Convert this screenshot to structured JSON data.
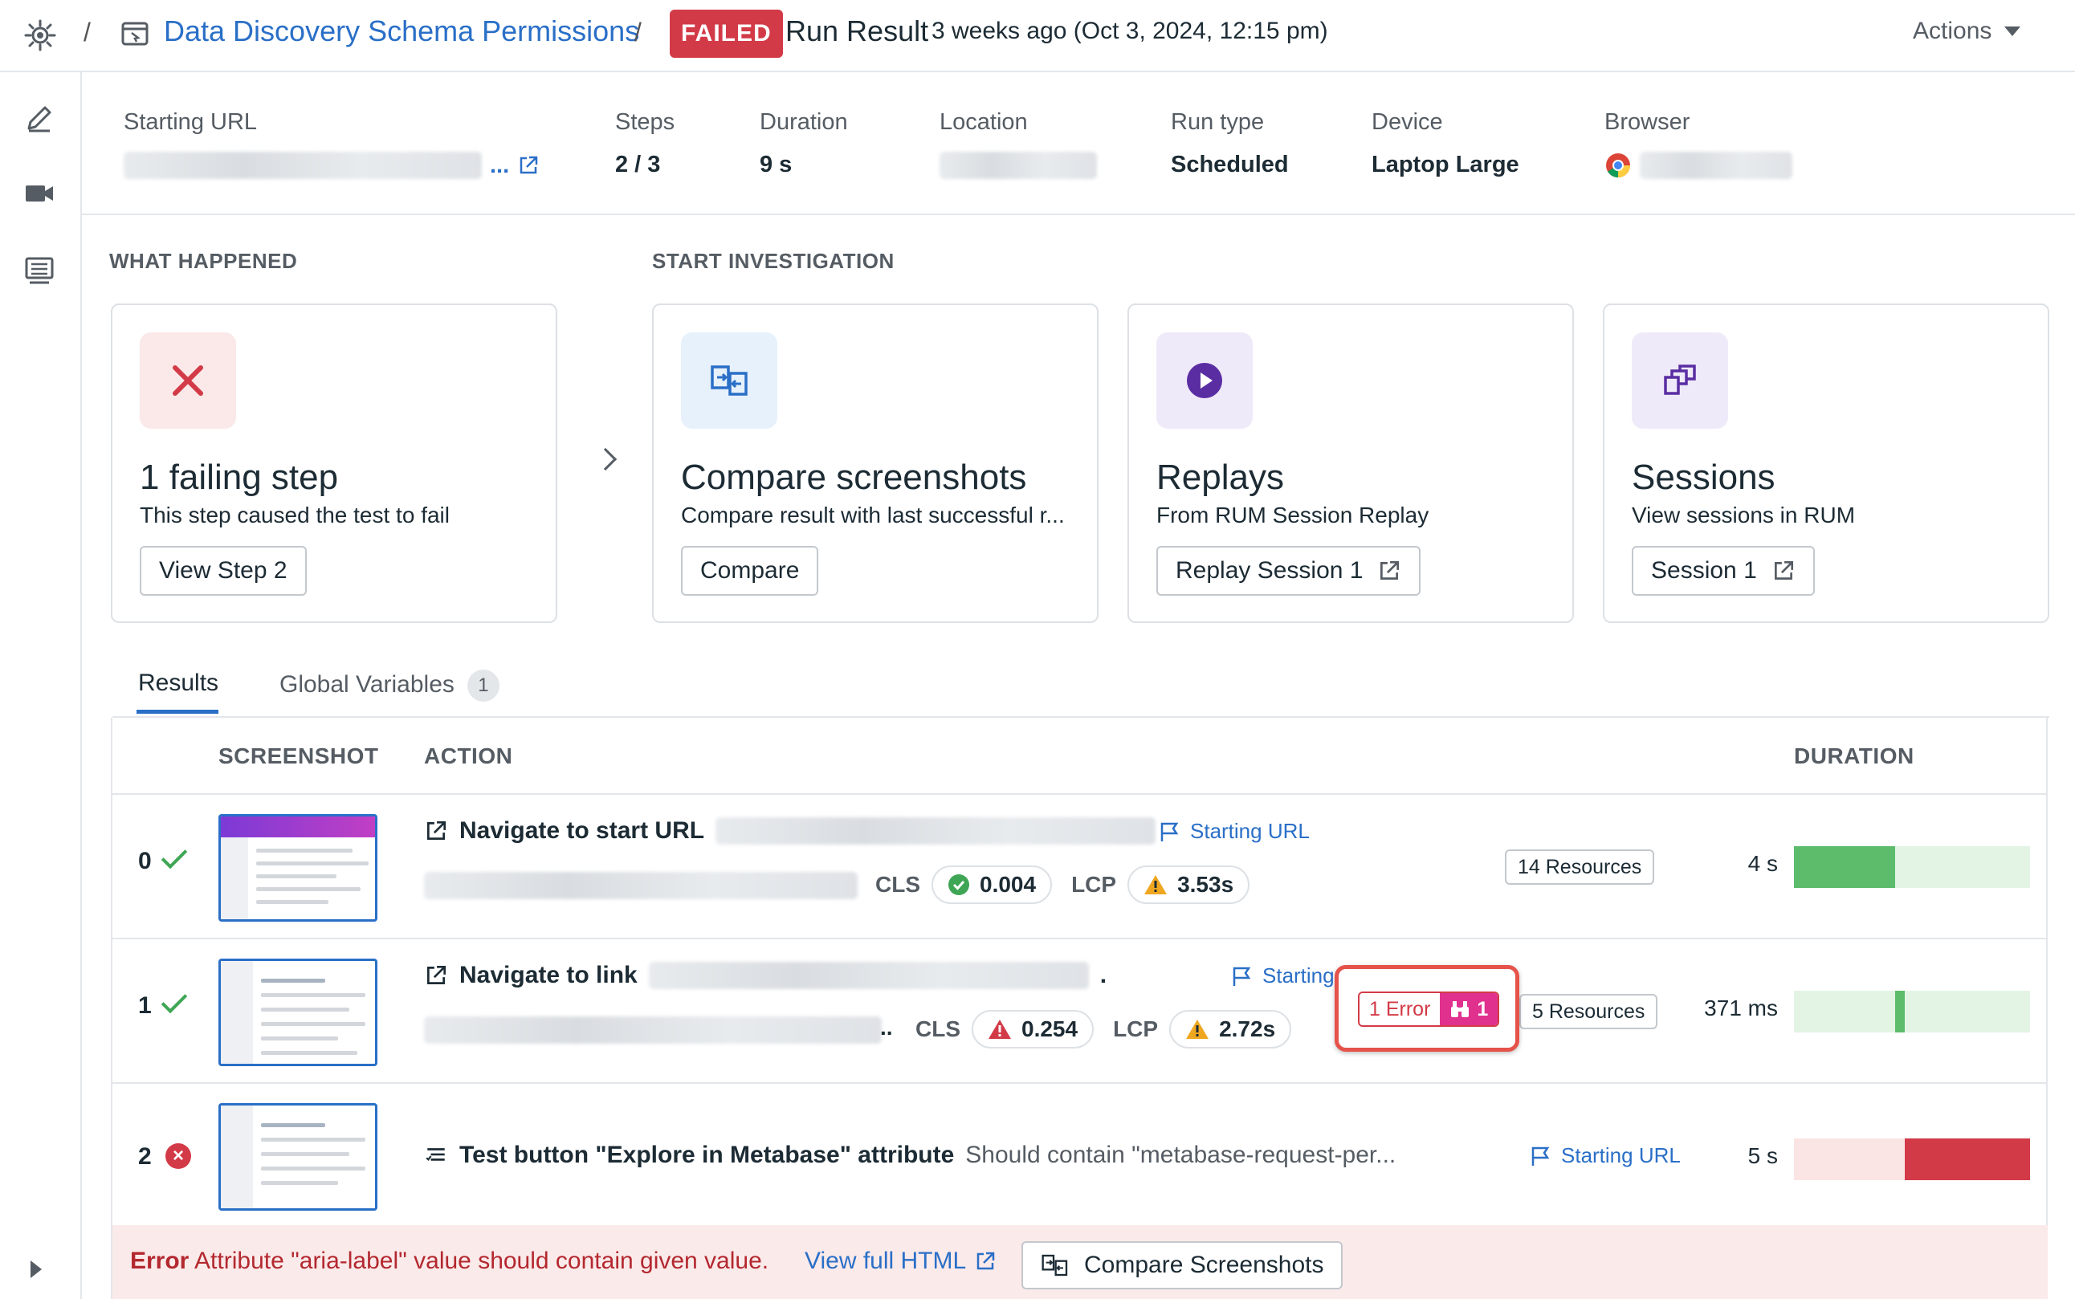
{
  "header": {
    "test_title": "Data Discovery Schema Permissions",
    "status_badge": "FAILED",
    "page_title": "Run Result",
    "run_time": "3 weeks ago (Oct 3, 2024, 12:15 pm)",
    "actions_label": "Actions",
    "separator": "/"
  },
  "meta": {
    "starting_url_label": "Starting URL",
    "starting_url_ellipsis": "...",
    "steps_label": "Steps",
    "steps_value": "2 / 3",
    "duration_label": "Duration",
    "duration_value": "9 s",
    "location_label": "Location",
    "run_type_label": "Run type",
    "run_type_value": "Scheduled",
    "device_label": "Device",
    "device_value": "Laptop Large",
    "browser_label": "Browser"
  },
  "sections": {
    "what_happened": "WHAT HAPPENED",
    "start_investigation": "START INVESTIGATION"
  },
  "cards": [
    {
      "title": "1 failing step",
      "desc": "This step caused the test to fail",
      "button": "View Step 2"
    },
    {
      "title": "Compare screenshots",
      "desc": "Compare result with last successful r...",
      "button": "Compare"
    },
    {
      "title": "Replays",
      "desc": "From RUM Session Replay",
      "button": "Replay Session 1"
    },
    {
      "title": "Sessions",
      "desc": "View sessions in RUM",
      "button": "Session 1"
    }
  ],
  "tabs": [
    {
      "label": "Results"
    },
    {
      "label": "Global Variables",
      "count": "1"
    }
  ],
  "table": {
    "headers": {
      "screenshot": "SCREENSHOT",
      "action": "ACTION",
      "duration": "DURATION"
    },
    "rows": [
      {
        "index": "0",
        "status": "passed",
        "action": "Navigate to start URL",
        "flag": "Starting URL",
        "cls_label": "CLS",
        "cls_value": "0.004",
        "lcp_label": "LCP",
        "lcp_value": "3.53s",
        "resources": "14 Resources",
        "duration": "4 s",
        "bar_offset": 0.0,
        "bar_fraction": 0.43
      },
      {
        "index": "1",
        "status": "passed",
        "action": "Navigate to link",
        "dot": ".",
        "ellipsis": "..",
        "flag": "Starting URL",
        "cls_label": "CLS",
        "cls_value": "0.254",
        "lcp_label": "LCP",
        "lcp_value": "2.72s",
        "errors": "1 Error",
        "error_count": "1",
        "resources": "5 Resources",
        "duration": "371 ms",
        "bar_offset": 0.43,
        "bar_fraction": 0.04
      },
      {
        "index": "2",
        "status": "failed",
        "status_glyph": "×",
        "action": "Test button \"Explore in Metabase\" attribute",
        "action_detail": "Should contain \"metabase-request-per...",
        "flag": "Starting URL",
        "duration": "5 s",
        "bar_offset": 0.47,
        "bar_fraction": 0.53
      }
    ]
  },
  "error_bar": {
    "label": "Error",
    "message": "Attribute \"aria-label\" value should contain given value.",
    "view_html": "View full HTML",
    "compare": "Compare Screenshots"
  },
  "colors": {
    "accent": "#2a6fc7",
    "failed": "#d33a47",
    "success": "#3ea655",
    "warning": "#f0a720",
    "rum_pink": "#e0318f"
  },
  "icons": {
    "logo": "datadog-logo-icon",
    "test": "browser-test-icon",
    "external": "external-link-icon",
    "flag": "flag-icon",
    "binoculars": "binoculars-icon"
  }
}
